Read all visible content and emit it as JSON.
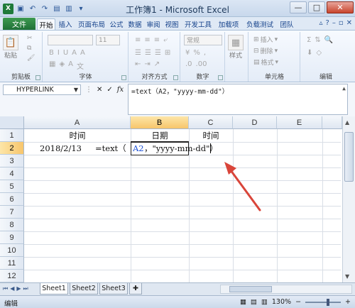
{
  "window": {
    "title": "工作簿1 - Microsoft Excel",
    "minimize": "—",
    "maximize": "□",
    "close": "✕"
  },
  "ribbon_tabs": {
    "file": "文件",
    "items": [
      "开始",
      "插入",
      "页面布局",
      "公式",
      "数据",
      "审阅",
      "视图",
      "开发工具",
      "加载项",
      "负载测试",
      "团队"
    ],
    "active": "开始"
  },
  "ribbon": {
    "paste_label": "粘贴",
    "font_size_value": "11",
    "number_format_value": "常规",
    "style_label": "样式",
    "insert_label": "插入",
    "delete_label": "删除",
    "format_label": "格式",
    "group_labels": [
      "剪贴板",
      "字体",
      "对齐方式",
      "数字",
      "单元格",
      "编辑"
    ]
  },
  "formula_bar": {
    "name_box": "HYPERLINK",
    "cancel": "✕",
    "enter": "✓",
    "fx": "fx",
    "formula": "=text（A2，\"yyyy-mm-dd\"）"
  },
  "sheet": {
    "columns": [
      "A",
      "B",
      "C",
      "D",
      "E"
    ],
    "selected_column": "B",
    "rows": [
      "1",
      "2",
      "3",
      "4",
      "5",
      "6",
      "7",
      "8",
      "9",
      "10",
      "11",
      "12"
    ],
    "selected_row": "2",
    "cells": {
      "A1": "时间",
      "B1": "日期",
      "C1": "时间",
      "A2": "2018/2/13",
      "A2_formula_prefix": "=text（",
      "B2_ref": "A2",
      "B2_rest": "，\"yyyy-mm-dd\"）"
    }
  },
  "sheet_tabs": [
    "Sheet1",
    "Sheet2",
    "Sheet3"
  ],
  "status": {
    "mode": "编辑",
    "zoom": "130%"
  },
  "colors": {
    "accent_red": "#d9453a",
    "file_tab": "#1f7037",
    "ref_blue": "#1a4fd6"
  }
}
